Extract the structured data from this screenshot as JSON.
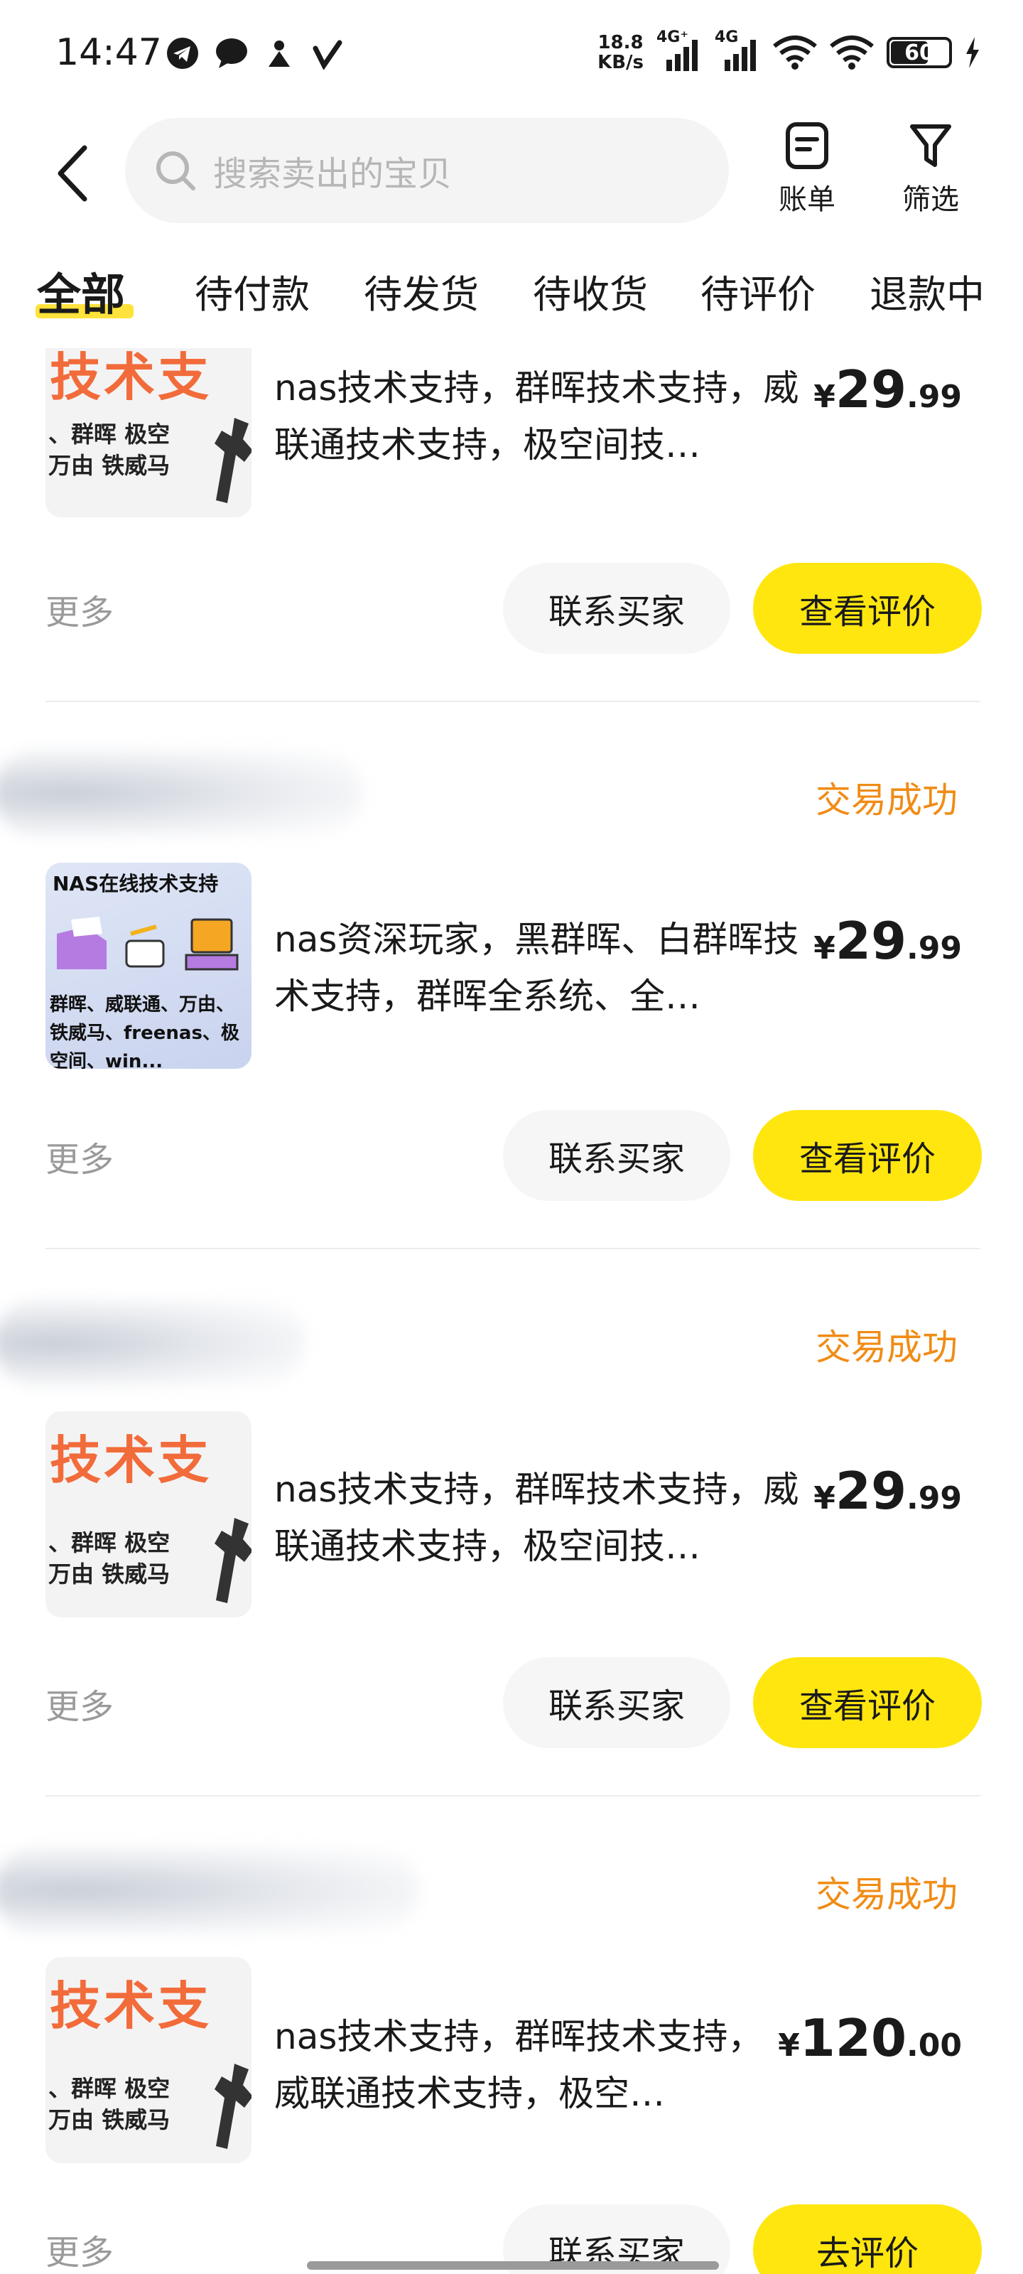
{
  "status_bar": {
    "time": "14:47",
    "net_speed_value": "18.8",
    "net_speed_unit": "KB/s",
    "signal1_label": "4G⁺",
    "signal2_label": "4G",
    "battery": "60",
    "icons": [
      "telegram-icon",
      "chat-bubble-icon",
      "person-icon",
      "v-check-icon",
      "signal-icon",
      "wifi-icon",
      "battery-icon",
      "charging-icon"
    ]
  },
  "header": {
    "search_placeholder": "搜索卖出的宝贝",
    "bill_label": "账单",
    "filter_label": "筛选"
  },
  "tabs": [
    "全部",
    "待付款",
    "待发货",
    "待收货",
    "待评价",
    "退款中"
  ],
  "orders": [
    {
      "status": "",
      "title": "nas技术支持，群晖技术支持，威联通技术支持，极空间技…",
      "price_currency": "¥",
      "price_int": "29",
      "price_dec": ".99",
      "thumb_big": "技术支",
      "thumb_line1": "、群晖 极空",
      "thumb_line2": "万由 铁威马",
      "more": "更多",
      "contact": "联系买家",
      "action": "查看评价"
    },
    {
      "status": "交易成功",
      "title": "nas资深玩家，黑群晖、白群晖技术支持，群晖全系统、全…",
      "price_currency": "¥",
      "price_int": "29",
      "price_dec": ".99",
      "thumb_title": "NAS在线技术支持",
      "thumb_body": "群晖、威联通、万由、铁威马、freenas、极空间、win...",
      "more": "更多",
      "contact": "联系买家",
      "action": "查看评价"
    },
    {
      "status": "交易成功",
      "title": "nas技术支持，群晖技术支持，威联通技术支持，极空间技…",
      "price_currency": "¥",
      "price_int": "29",
      "price_dec": ".99",
      "thumb_big": "技术支",
      "thumb_line1": "、群晖 极空",
      "thumb_line2": "万由 铁威马",
      "more": "更多",
      "contact": "联系买家",
      "action": "查看评价"
    },
    {
      "status": "交易成功",
      "title": "nas技术支持，群晖技术支持，威联通技术支持，极空…",
      "price_currency": "¥",
      "price_int": "120",
      "price_dec": ".00",
      "thumb_big": "技术支",
      "thumb_line1": "、群晖 极空",
      "thumb_line2": "万由 铁威马",
      "more": "更多",
      "contact": "联系买家",
      "action": "去评价"
    }
  ],
  "colors": {
    "accent_yellow": "#ffe60f",
    "status_orange": "#f08c16",
    "thumb_orange": "#f26b3a"
  }
}
